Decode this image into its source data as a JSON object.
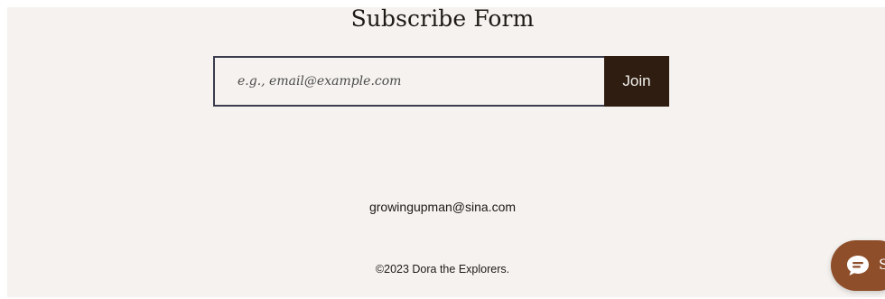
{
  "subscribe": {
    "title": "Subscribe Form",
    "email_placeholder": "e.g., email@example.com",
    "email_value": "",
    "join_label": "Join"
  },
  "footer": {
    "contact_email": "growingupman@sina.com",
    "copyright": "©2023 Dora the Explorers."
  },
  "chat_widget": {
    "icon": "chat-bubble-icon",
    "label_visible": "S"
  },
  "colors": {
    "background": "#f5f2ef",
    "join_button": "#2e1d10",
    "input_border": "#3b3d4e",
    "chat_widget": "#8f4e2a"
  }
}
